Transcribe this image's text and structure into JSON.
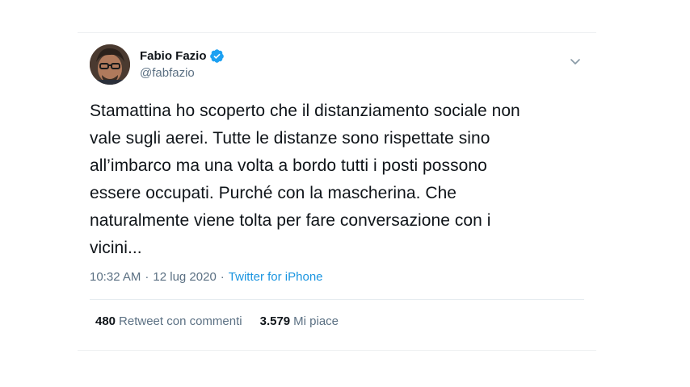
{
  "author": {
    "display_name": "Fabio Fazio",
    "handle": "@fabfazio",
    "verified": true,
    "avatar_icon": "profile-photo"
  },
  "tweet": {
    "text": "Stamattina ho scoperto che il distanziamento sociale non\nvale sugli aerei. Tutte le distanze sono rispettate sino\nall’imbarco ma una volta a bordo tutti i posti possono\nessere occupati. Purché con la mascherina. Che\nnaturalmente viene tolta per fare conversazione con i\nvicini...",
    "time": "10:32 AM",
    "separator1": "·",
    "date": "12 lug 2020",
    "separator2": "·",
    "source": "Twitter for iPhone"
  },
  "stats": {
    "retweets_count": "480",
    "retweets_label": "Retweet con commenti",
    "likes_count": "3.579",
    "likes_label": "Mi piace"
  },
  "colors": {
    "accent": "#1b95e0",
    "verified": "#1da1f2",
    "secondary_text": "#5b7083"
  }
}
